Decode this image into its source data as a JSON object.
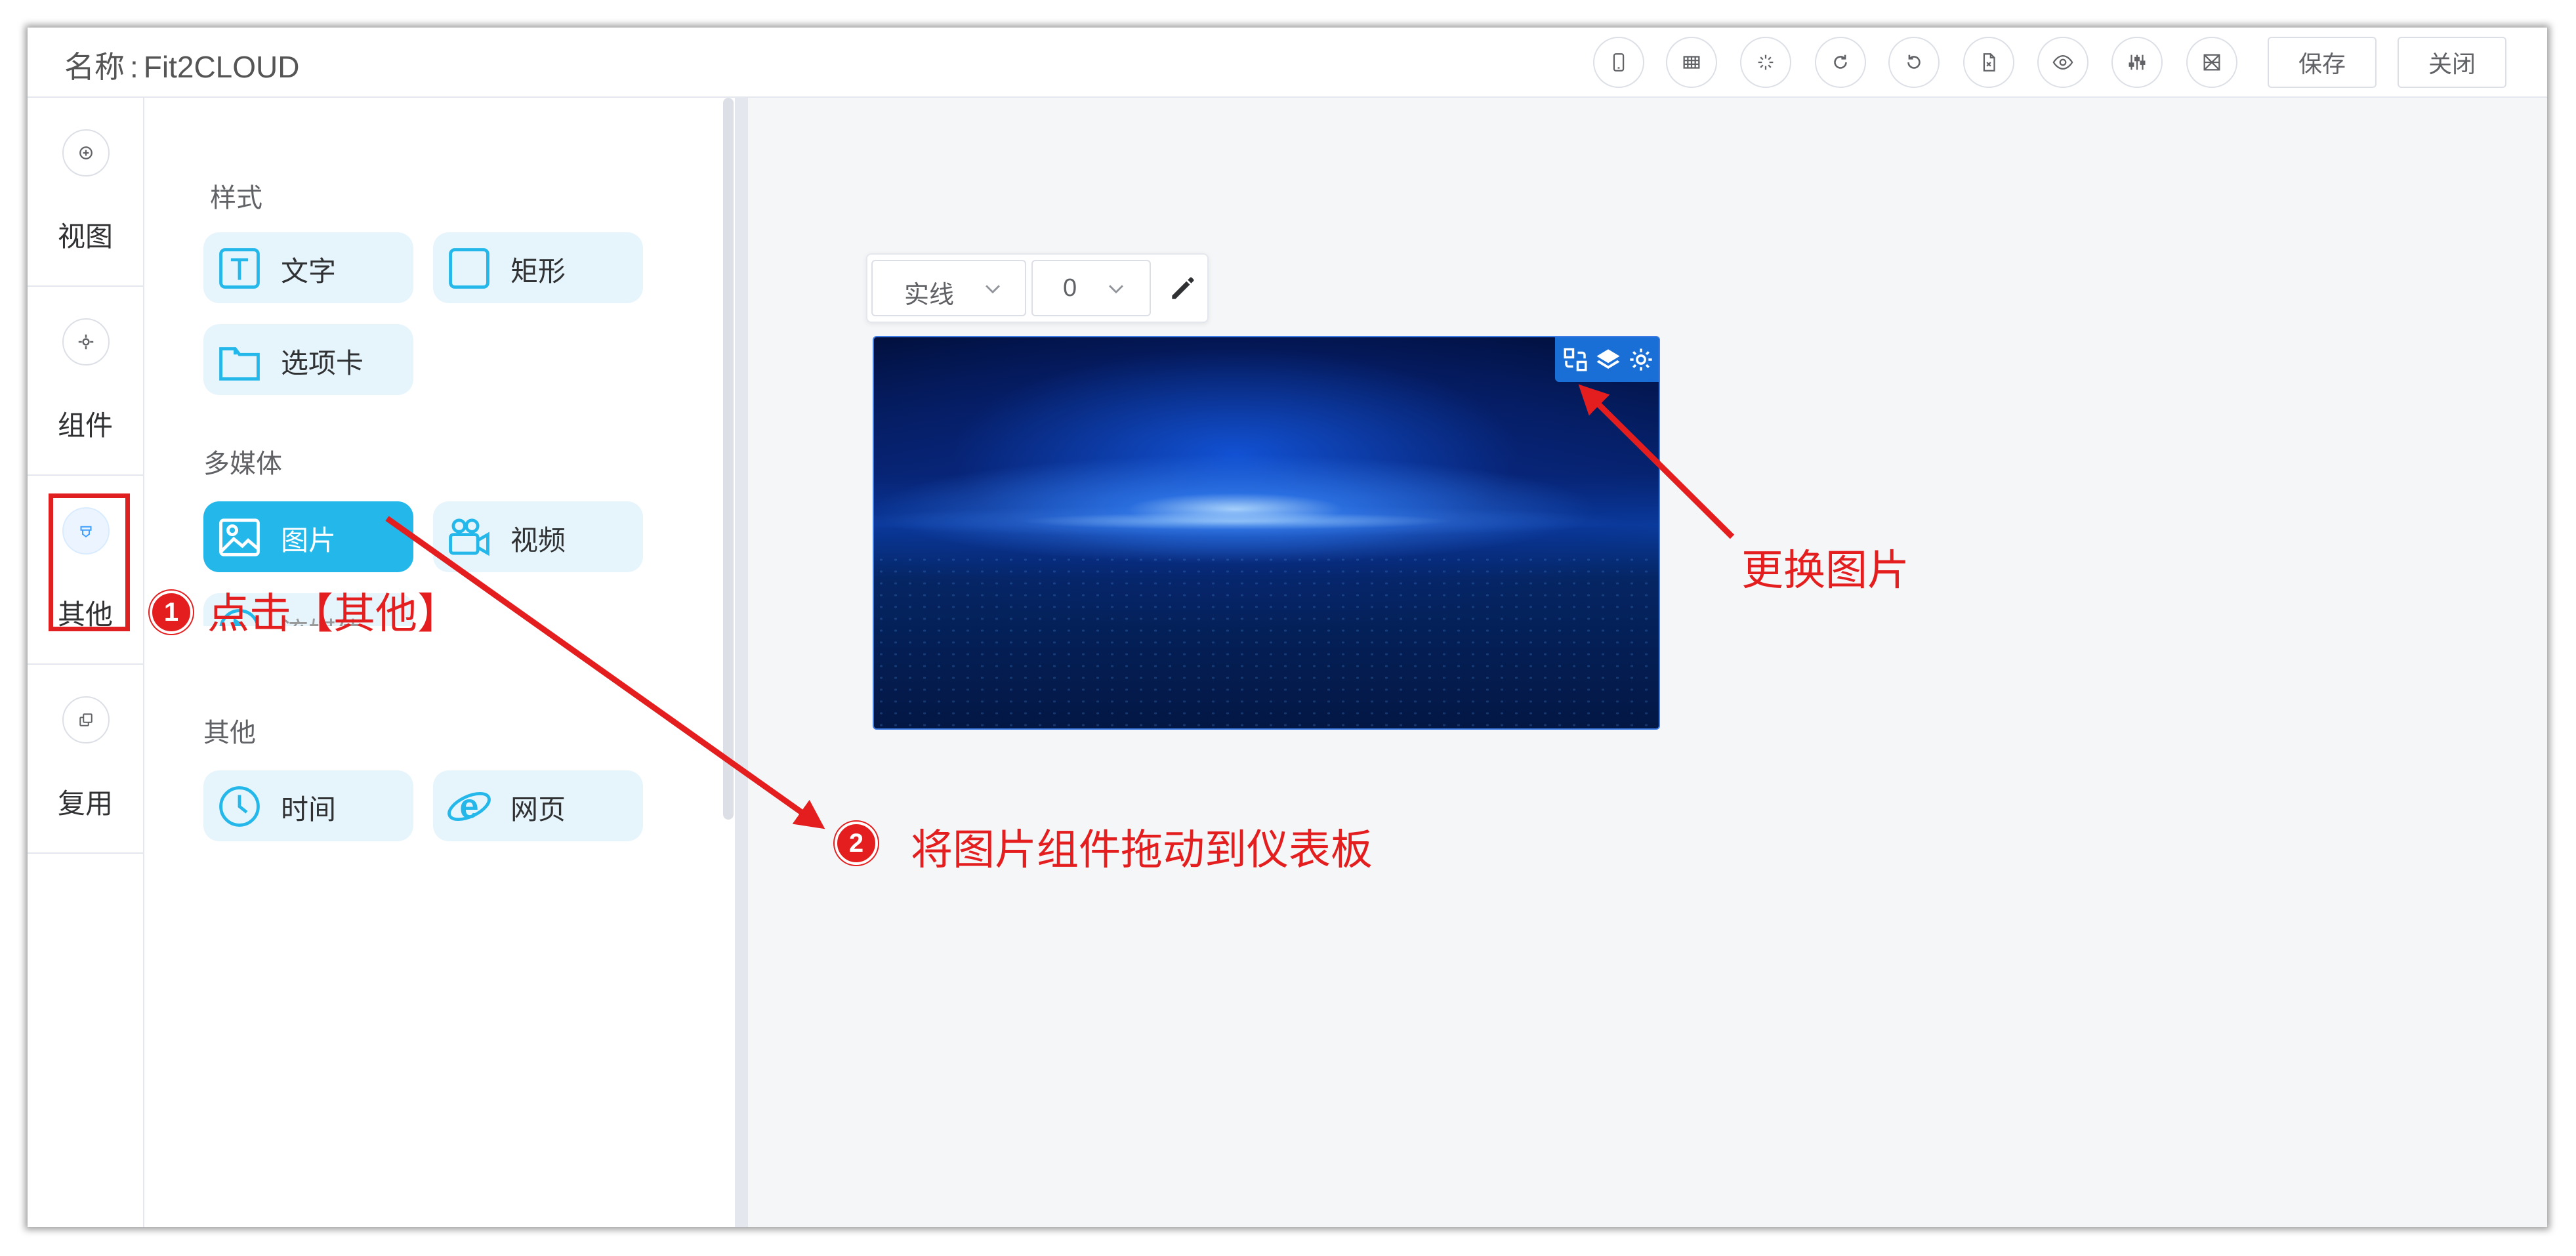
{
  "header": {
    "name_label": "名称",
    "name_sep": ":",
    "name_value": "Fit2CLOUD",
    "toolbar_icons": [
      "mobile-icon",
      "grid-icon",
      "spinner-icon",
      "redo-icon",
      "undo-icon",
      "export-icon",
      "preview-icon",
      "adjust-icon",
      "clear-icon"
    ],
    "save_label": "保存",
    "close_label": "关闭"
  },
  "leftnav": {
    "items": [
      {
        "label": "视图",
        "icon": "plus-circle-icon"
      },
      {
        "label": "组件",
        "icon": "gear-icon"
      },
      {
        "label": "其他",
        "icon": "shirt-icon"
      },
      {
        "label": "复用",
        "icon": "copy-icon"
      }
    ]
  },
  "panel": {
    "section_style": "样式",
    "section_media": "多媒体",
    "section_other": "其他",
    "style_items": [
      "文字",
      "矩形",
      "选项卡"
    ],
    "media_items": [
      "图片",
      "视频",
      "流媒体"
    ],
    "other_items": [
      "时间",
      "网页"
    ]
  },
  "canvas": {
    "line_style": "实线",
    "line_width": "0"
  },
  "annotations": {
    "step1_num": "1",
    "step1_text": "点击【其他】",
    "step2_num": "2",
    "step2_text": "将图片组件拖动到仪表板",
    "replace_text": "更换图片",
    "color": "#e41e1e"
  }
}
